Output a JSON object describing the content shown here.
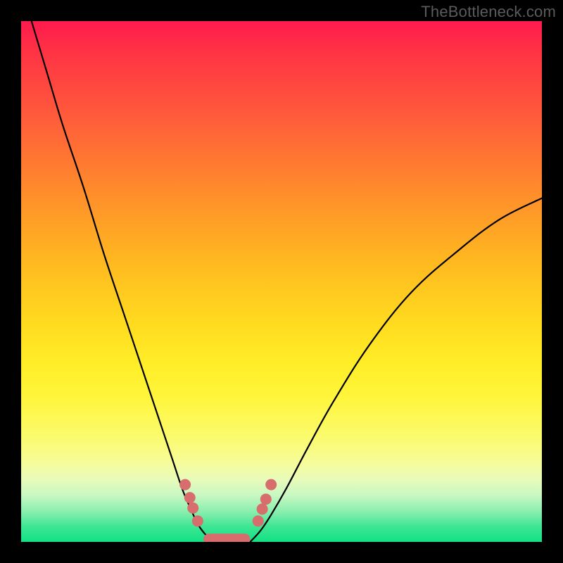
{
  "watermark": "TheBottleneck.com",
  "chart_data": {
    "type": "line",
    "title": "",
    "xlabel": "",
    "ylabel": "",
    "xlim": [
      0,
      100
    ],
    "ylim": [
      0,
      100
    ],
    "series": [
      {
        "name": "left-curve",
        "x": [
          2,
          5,
          8,
          12,
          16,
          20,
          24,
          27,
          29,
          31,
          32.5,
          34,
          35.5,
          37
        ],
        "values": [
          100,
          90,
          80,
          68,
          55,
          43,
          31,
          22,
          16,
          10,
          6.5,
          3.3,
          1.3,
          0
        ]
      },
      {
        "name": "right-curve",
        "x": [
          44,
          46,
          48,
          51,
          55,
          60,
          67,
          75,
          84,
          92,
          100
        ],
        "values": [
          0,
          2.2,
          5.2,
          10.4,
          18,
          27,
          38,
          48,
          56,
          62,
          66
        ]
      }
    ],
    "markers": {
      "dots_left": [
        {
          "x": 31.5,
          "y": 11
        },
        {
          "x": 32.4,
          "y": 8.5
        },
        {
          "x": 33.0,
          "y": 6.5
        },
        {
          "x": 33.9,
          "y": 4.0
        }
      ],
      "dots_right": [
        {
          "x": 45.5,
          "y": 4.0
        },
        {
          "x": 46.3,
          "y": 6.3
        },
        {
          "x": 47.0,
          "y": 8.2
        },
        {
          "x": 48.0,
          "y": 11.0
        }
      ],
      "flat_segment": {
        "x_start": 35,
        "x_end": 44,
        "y": 0.5
      }
    },
    "background_gradient": {
      "top": "#ff1a4e",
      "mid": "#ffee28",
      "bottom": "#12e183"
    }
  }
}
